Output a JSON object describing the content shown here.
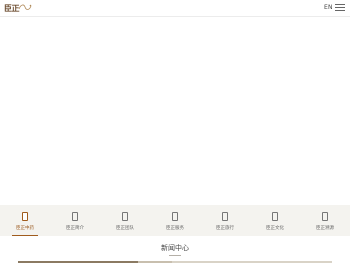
{
  "header": {
    "logo_text": "",
    "language_toggle": "EN",
    "menu_icon": "hamburger-menu-icon"
  },
  "nav": {
    "items": [
      {
        "label": "臣正中药",
        "icon": "tile-icon",
        "active": true
      },
      {
        "label": "臣正简介",
        "icon": "tile-icon",
        "active": false
      },
      {
        "label": "臣正团队",
        "icon": "tile-icon",
        "active": false
      },
      {
        "label": "臣正服务",
        "icon": "tile-icon",
        "active": false
      },
      {
        "label": "臣正旅行",
        "icon": "tile-icon",
        "active": false
      },
      {
        "label": "臣正文化",
        "icon": "tile-icon",
        "active": false
      },
      {
        "label": "臣正溯源",
        "icon": "tile-icon",
        "active": false
      }
    ]
  },
  "news": {
    "title": "新闻中心"
  },
  "colors": {
    "accent": "#a05c1d",
    "nav_background": "#f4f3ef",
    "text": "#555555"
  }
}
